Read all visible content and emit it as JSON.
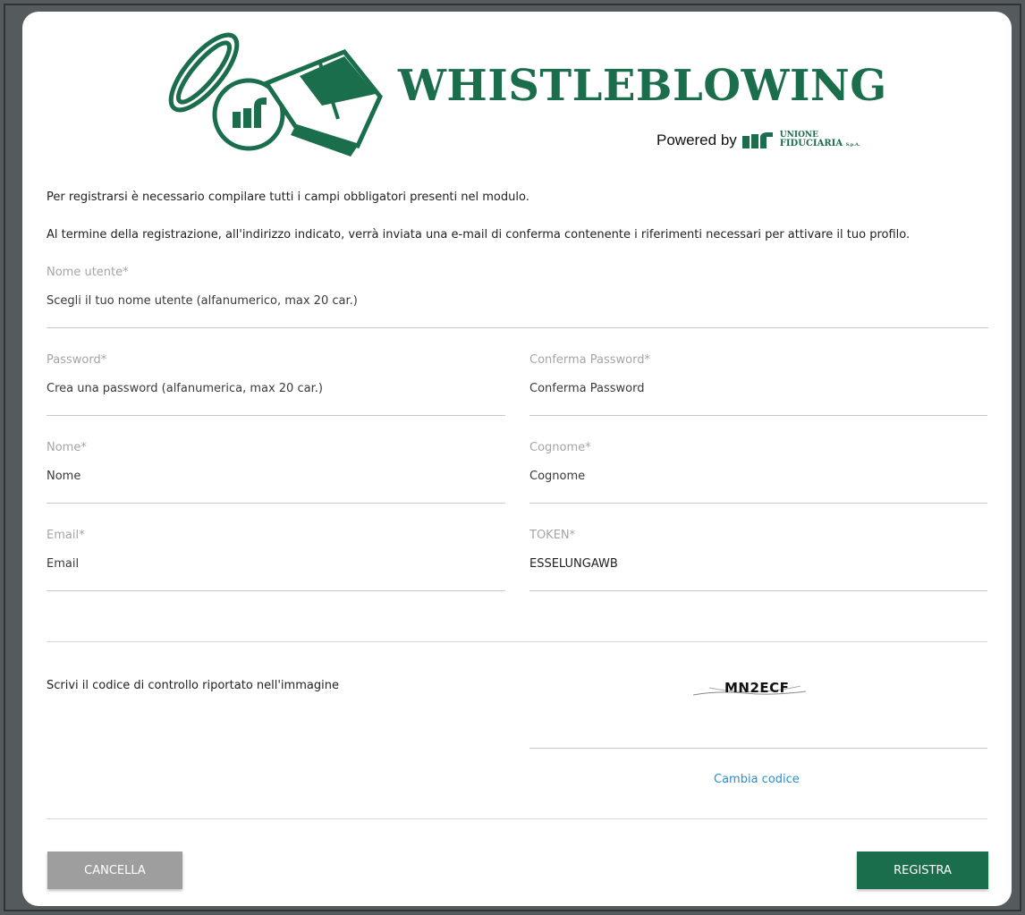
{
  "header": {
    "brand_title": "WHISTLEBLOWING",
    "powered_by": "Powered by",
    "partner_line1": "UNIONE",
    "partner_line2": "FIDUCIARIA",
    "partner_suffix": "S.p.A."
  },
  "intro": {
    "line1": "Per registrarsi è necessario compilare tutti i campi obbligatori presenti nel modulo.",
    "line2": "Al termine della registrazione, all'indirizzo indicato, verrà inviata una e-mail di conferma contenente i riferimenti necessari per attivare il tuo profilo."
  },
  "form": {
    "username": {
      "label": "Nome utente*",
      "placeholder": "Scegli il tuo nome utente (alfanumerico, max 20 car.)"
    },
    "password": {
      "label": "Password*",
      "placeholder": "Crea una password (alfanumerica, max 20 car.)"
    },
    "confirm_password": {
      "label": "Conferma Password*",
      "placeholder": "Conferma Password"
    },
    "first_name": {
      "label": "Nome*",
      "placeholder": "Nome"
    },
    "last_name": {
      "label": "Cognome*",
      "placeholder": "Cognome"
    },
    "email": {
      "label": "Email*",
      "placeholder": "Email"
    },
    "token": {
      "label": "TOKEN*",
      "value": "ESSELUNGAWB"
    }
  },
  "captcha": {
    "label": "Scrivi il codice di controllo riportato nell'immagine",
    "code": "MN2ECF",
    "change_label": "Cambia codice"
  },
  "buttons": {
    "cancel": "CANCELLA",
    "submit": "REGISTRA"
  },
  "colors": {
    "brand_green": "#1a6e4c",
    "link_blue": "#2a8ed1",
    "cancel_gray": "#9e9e9e"
  }
}
